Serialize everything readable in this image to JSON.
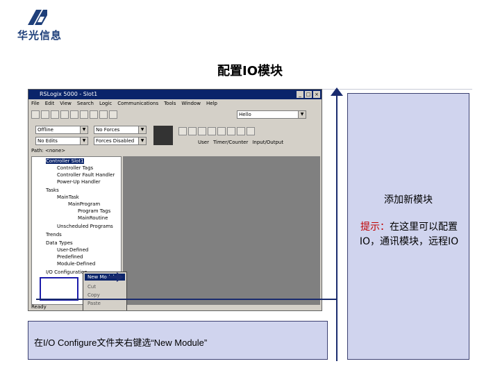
{
  "logo": {
    "text": "华光信息"
  },
  "slide": {
    "title": "配置IO模块"
  },
  "window": {
    "title": "RSLogix 5000 - Slot1",
    "buttons": [
      "_",
      "□",
      "×"
    ],
    "menu": [
      "File",
      "Edit",
      "View",
      "Search",
      "Logic",
      "Communications",
      "Tools",
      "Window",
      "Help"
    ],
    "combo_main": "Hello",
    "mode_combo": "Offline",
    "forces_combo": "No Forces",
    "edits_combo": "No Edits",
    "forces_disabled_combo": "Forces Disabled",
    "path": "Path: <none>",
    "tabs": [
      "User",
      "Timer/Counter",
      "Input/Output"
    ],
    "tree": [
      "Controller Slot1",
      "Controller Tags",
      "Controller Fault Handler",
      "Power-Up Handler",
      "Tasks",
      "MainTask",
      "MainProgram",
      "Program Tags",
      "MainRoutine",
      "Unscheduled Programs",
      "Trends",
      "Data Types",
      "User-Defined",
      "Predefined",
      "Module-Defined",
      "I/O Configuration"
    ],
    "context_menu": [
      "New Module...",
      "Cut",
      "Copy",
      "Paste"
    ],
    "status": "Ready"
  },
  "side_panel": {
    "title": "添加新模块",
    "tip_label": "提示：",
    "tip_text": "在这里可以配置IO，通讯模块，远程IO"
  },
  "caption": {
    "text": "在I/O Configure文件夹右键选“New Module”"
  },
  "colors": {
    "accent": "#1a2b6e",
    "panel": "#d0d4ee",
    "tip": "#c00000"
  }
}
